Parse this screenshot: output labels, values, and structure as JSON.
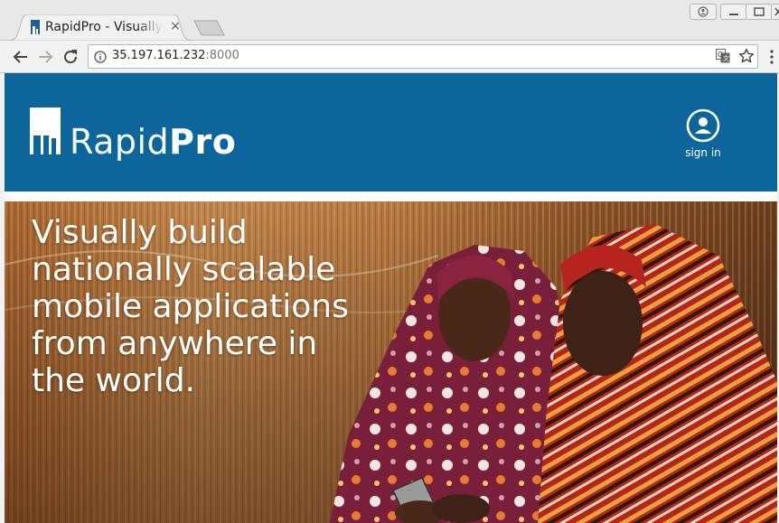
{
  "browser": {
    "tab": {
      "title": "RapidPro - Visually build nationally scalable mobile applications from anywhere in the world.",
      "close": "×"
    },
    "address": {
      "host": "35.197.161.232",
      "port": ":8000"
    },
    "icons": {
      "back": "arrow-left-icon",
      "forward": "arrow-right-icon",
      "reload": "reload-icon",
      "info": "info-icon",
      "translate": "translate-icon",
      "bookmark": "star-icon",
      "menu": "kebab-menu-icon",
      "profile": "profile-icon",
      "minimize": "minimize-icon",
      "maximize": "maximize-icon",
      "close": "close-icon"
    }
  },
  "site": {
    "logo": {
      "light": "Rapid",
      "bold": "Pro"
    },
    "signin": {
      "label": "sign in"
    },
    "hero": {
      "title": "Visually build nationally scalable mobile applications from anywhere in the world."
    },
    "colors": {
      "header": "#0c669c",
      "accent": "#1f5f96"
    }
  }
}
